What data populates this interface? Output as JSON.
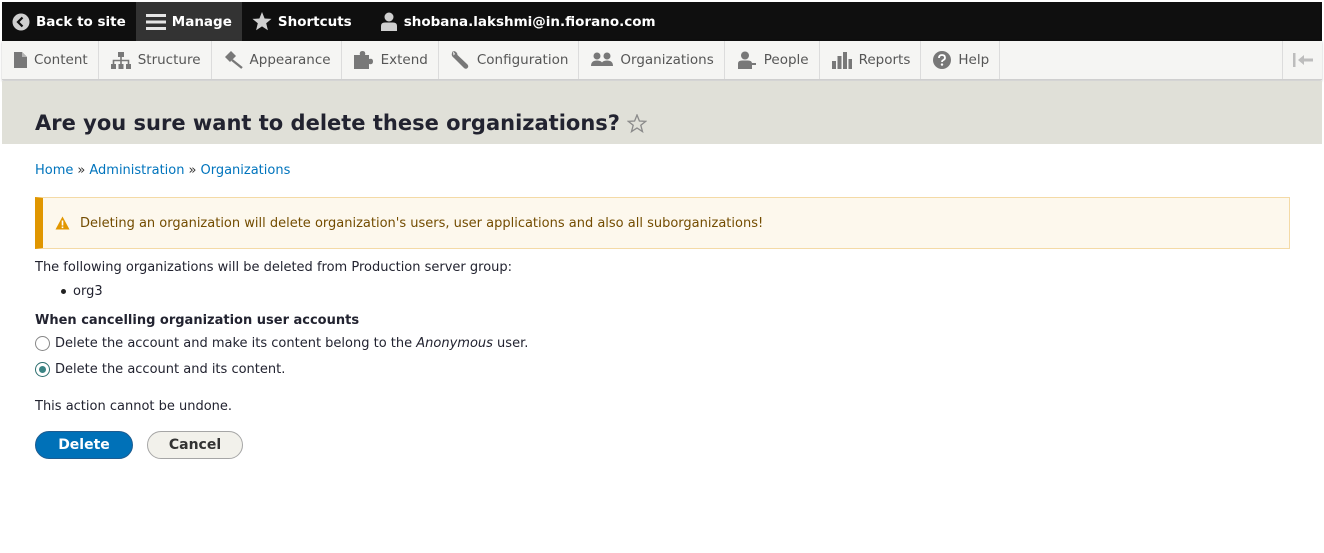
{
  "toolbar": {
    "back_to_site": "Back to site",
    "manage": "Manage",
    "shortcuts": "Shortcuts",
    "user": "shobana.lakshmi@in.fiorano.com"
  },
  "tray": {
    "items": [
      {
        "label": "Content",
        "icon": "page-icon"
      },
      {
        "label": "Structure",
        "icon": "sitemap-icon"
      },
      {
        "label": "Appearance",
        "icon": "paintbrush-icon"
      },
      {
        "label": "Extend",
        "icon": "puzzle-icon"
      },
      {
        "label": "Configuration",
        "icon": "wrench-icon"
      },
      {
        "label": "Organizations",
        "icon": "people-group-icon"
      },
      {
        "label": "People",
        "icon": "person-icon"
      },
      {
        "label": "Reports",
        "icon": "bar-chart-icon"
      },
      {
        "label": "Help",
        "icon": "help-icon"
      }
    ]
  },
  "page": {
    "title": "Are you sure want to delete these organizations?"
  },
  "breadcrumb": {
    "items": [
      "Home",
      "Administration",
      "Organizations"
    ],
    "separator": "»"
  },
  "warning": {
    "message": "Deleting an organization will delete organization's users, user applications and also all suborganizations!"
  },
  "content": {
    "intro": "The following organizations will be deleted from Production server group:",
    "orgs": [
      "org3"
    ],
    "fieldset_title": "When cancelling organization user accounts",
    "option1_before": "Delete the account and make its content belong to the ",
    "option1_em": "Anonymous",
    "option1_after": " user.",
    "option2": "Delete the account and its content.",
    "selected_option": 2,
    "undone": "This action cannot be undone."
  },
  "actions": {
    "delete": "Delete",
    "cancel": "Cancel"
  },
  "colors": {
    "toolbar_bg": "#0f0f0f",
    "link": "#0074bd",
    "primary_button": "#0071b8",
    "warning_border": "#e09600"
  }
}
